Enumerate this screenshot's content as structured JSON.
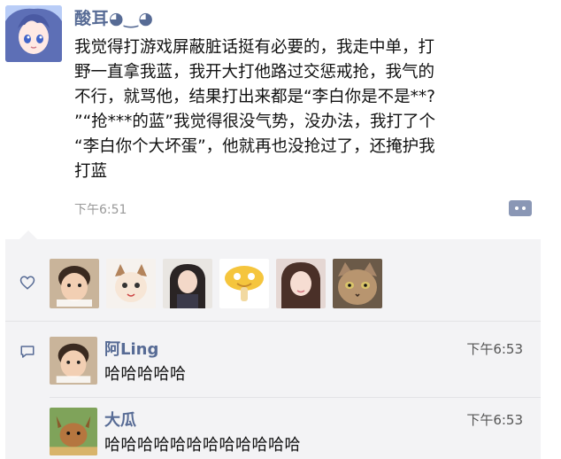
{
  "post": {
    "author": "酸耳◕‿◕",
    "text": "我觉得打游戏屏蔽脏话挺有必要的，我走中单，打\n野一直拿我蓝，我开大打他路过交惩戒抢，我气的\n不行，就骂他，结果打出来都是“李白你是不是**?\n”“抢***的蓝”我觉得很没气势，没办法，我打了个\n“李白你个大坏蛋”，他就再也没抢过了，还掩护我\n打蓝",
    "time": "下午6:51"
  },
  "likes": {
    "icon": "heart-outline-icon",
    "count": 6
  },
  "comments": [
    {
      "name": "阿Ling",
      "time": "下午6:53",
      "text": "哈哈哈哈哈"
    },
    {
      "name": "大瓜",
      "time": "下午6:53",
      "text": "哈哈哈哈哈哈哈哈哈哈哈哈"
    }
  ],
  "colors": {
    "name": "#576b95",
    "panel": "#f3f3f5",
    "meta": "#999999"
  }
}
